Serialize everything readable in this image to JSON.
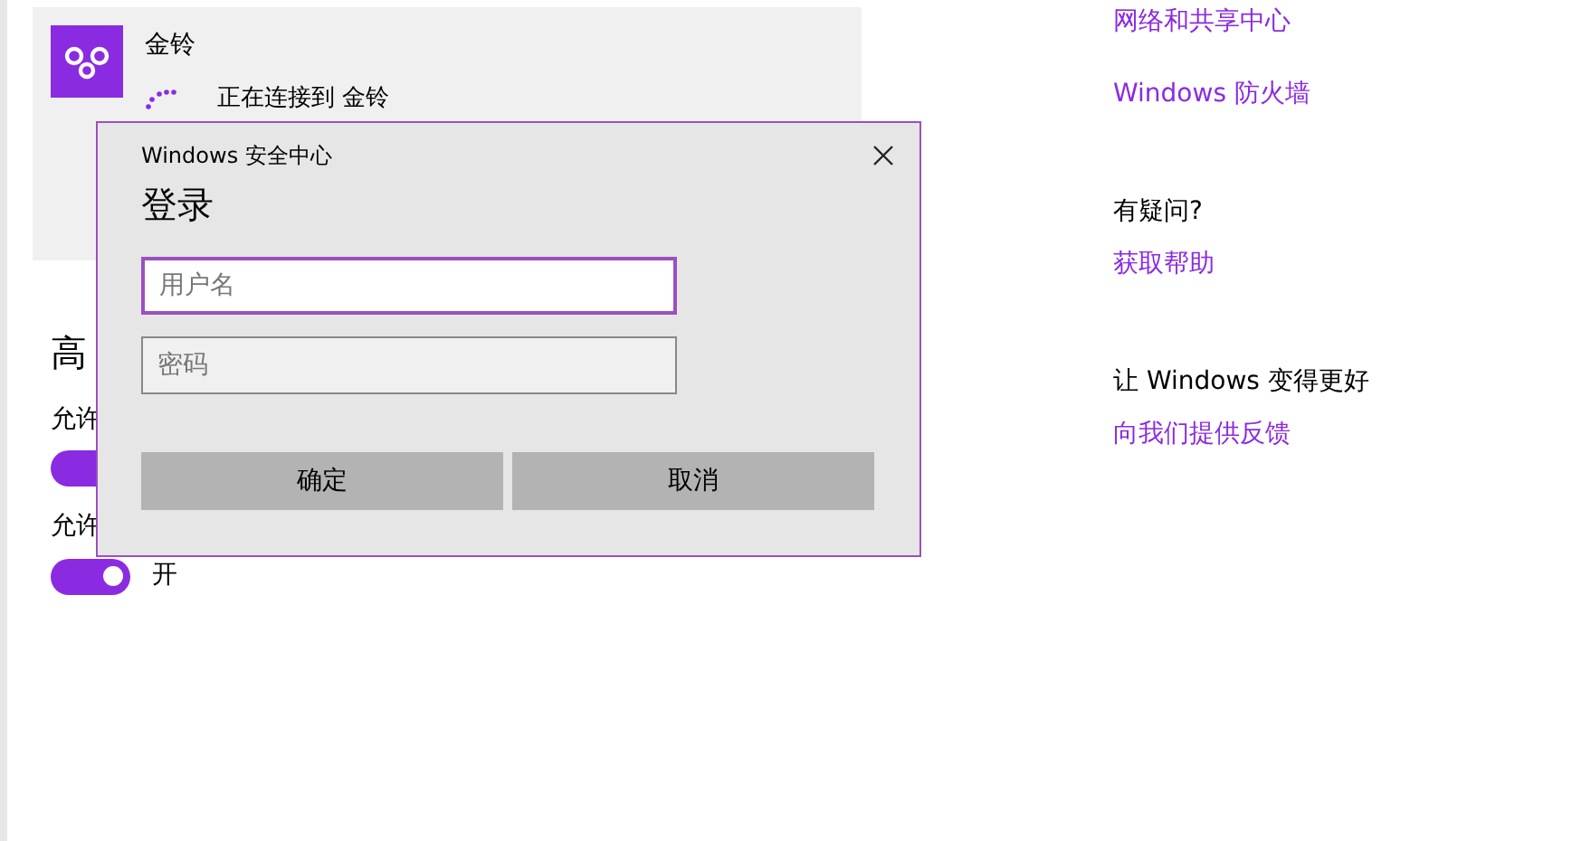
{
  "network": {
    "name": "金铃",
    "status": "正在连接到 金铃"
  },
  "advanced": {
    "heading": "高",
    "settings": [
      {
        "label": "允许",
        "on": true
      },
      {
        "label": "允许",
        "on": true,
        "state_text": "开"
      }
    ]
  },
  "sidebar": {
    "groups": [
      {
        "links": [
          "网络和共享中心",
          "Windows 防火墙"
        ]
      },
      {
        "title": "有疑问?",
        "links": [
          "获取帮助"
        ]
      },
      {
        "title": "让 Windows 变得更好",
        "links": [
          "向我们提供反馈"
        ]
      }
    ]
  },
  "dialog": {
    "title": "Windows 安全中心",
    "heading": "登录",
    "fields": [
      {
        "placeholder": "用户名",
        "focused": true
      },
      {
        "placeholder": "密码",
        "focused": false
      }
    ],
    "buttons": [
      "确定",
      "取消"
    ]
  }
}
